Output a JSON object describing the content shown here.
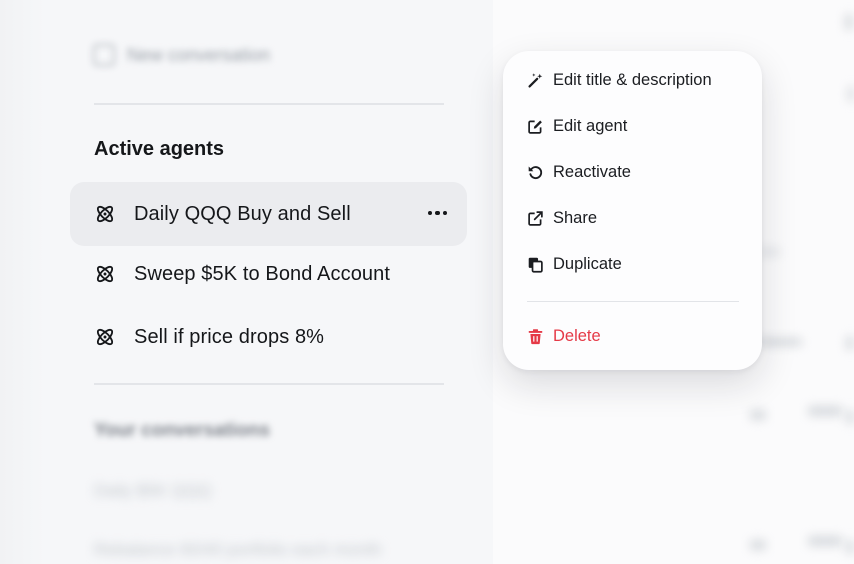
{
  "sidebar": {
    "new_conversation": "New conversation",
    "active_agents_title": "Active agents",
    "agents": [
      {
        "label": "Daily QQQ Buy and Sell",
        "active": true
      },
      {
        "label": "Sweep $5K to Bond Account",
        "active": false
      },
      {
        "label": "Sell if price drops 8%",
        "active": false
      }
    ],
    "conversations_title": "Your conversations",
    "conversations": [
      "Daily $5K QQQ",
      "Rebalance 60/40 portfolio each month"
    ]
  },
  "context_menu": {
    "items": [
      {
        "label": "Edit title & description",
        "icon": "magic-wand-icon"
      },
      {
        "label": "Edit agent",
        "icon": "edit-square-icon"
      },
      {
        "label": "Reactivate",
        "icon": "rotate-ccw-icon"
      },
      {
        "label": "Share",
        "icon": "external-link-icon"
      },
      {
        "label": "Duplicate",
        "icon": "copy-icon"
      }
    ],
    "delete_label": "Delete",
    "danger_color": "#e53a47"
  }
}
